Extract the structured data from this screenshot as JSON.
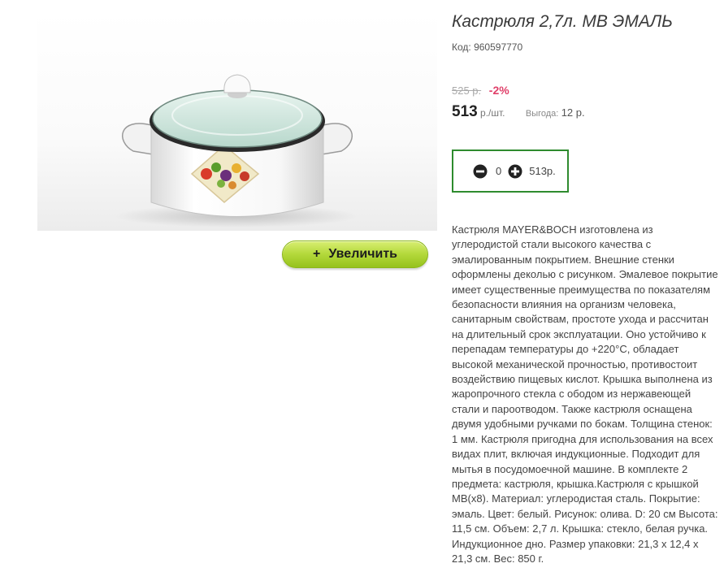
{
  "product": {
    "title": "Кастрюля 2,7л. MB ЭМАЛЬ",
    "code": "Код: 960597770",
    "image_alt": "enamel-saucepan-photo"
  },
  "zoom": {
    "icon": "plus-icon",
    "symbol": "+",
    "label": "Увеличить"
  },
  "price": {
    "old": "525 р.",
    "discount": "-2%",
    "current": "513",
    "unit": "р./шт.",
    "saving_label": "Выгода:",
    "saving_value": "12 р."
  },
  "quantity": {
    "count": "0",
    "total": "513р.",
    "minus_icon": "minus-circle-icon",
    "plus_icon": "plus-circle-icon"
  },
  "description": "Кастрюля MAYER&BOCH изготовлена из углеродистой стали высокого качества с эмалированным покрытием. Внешние стенки оформлены деколью с рисунком. Эмалевое покрытие имеет существенные преимущества по показателям безопасности влияния на организм человека, санитарным свойствам, простоте ухода и рассчитан на длительный срок эксплуатации. Оно устойчиво к перепадам температуры до +220°C, обладает высокой механической прочностью, противостоит воздействию пищевых кислот. Крышка выполнена из жаропрочного стекла с ободом из нержавеющей стали и пароотводом. Также кастрюля оснащена двумя удобными ручками по бокам. Толщина стенок: 1 мм. Кастрюля пригодна для использования на всех видах плит, включая индукционные. Подходит для мытья в посудомоечной машине. В комплекте 2 предмета: кастрюля, крышка.Кастрюля с крышкой MB(x8). Материал: углеродистая сталь. Покрытие: эмаль. Цвет: белый. Рисунок: олива. D: 20 см Высота: 11,5 см. Объем: 2,7 л. Крышка: стекло, белая ручка. Индукционное дно. Размер упаковки: 21,3 х 12,4 х 21,3 см. Вес: 850 г.",
  "colors": {
    "accent_green": "#2e8b2e",
    "button_green": "#b3d83a",
    "discount_red": "#e0406a"
  }
}
